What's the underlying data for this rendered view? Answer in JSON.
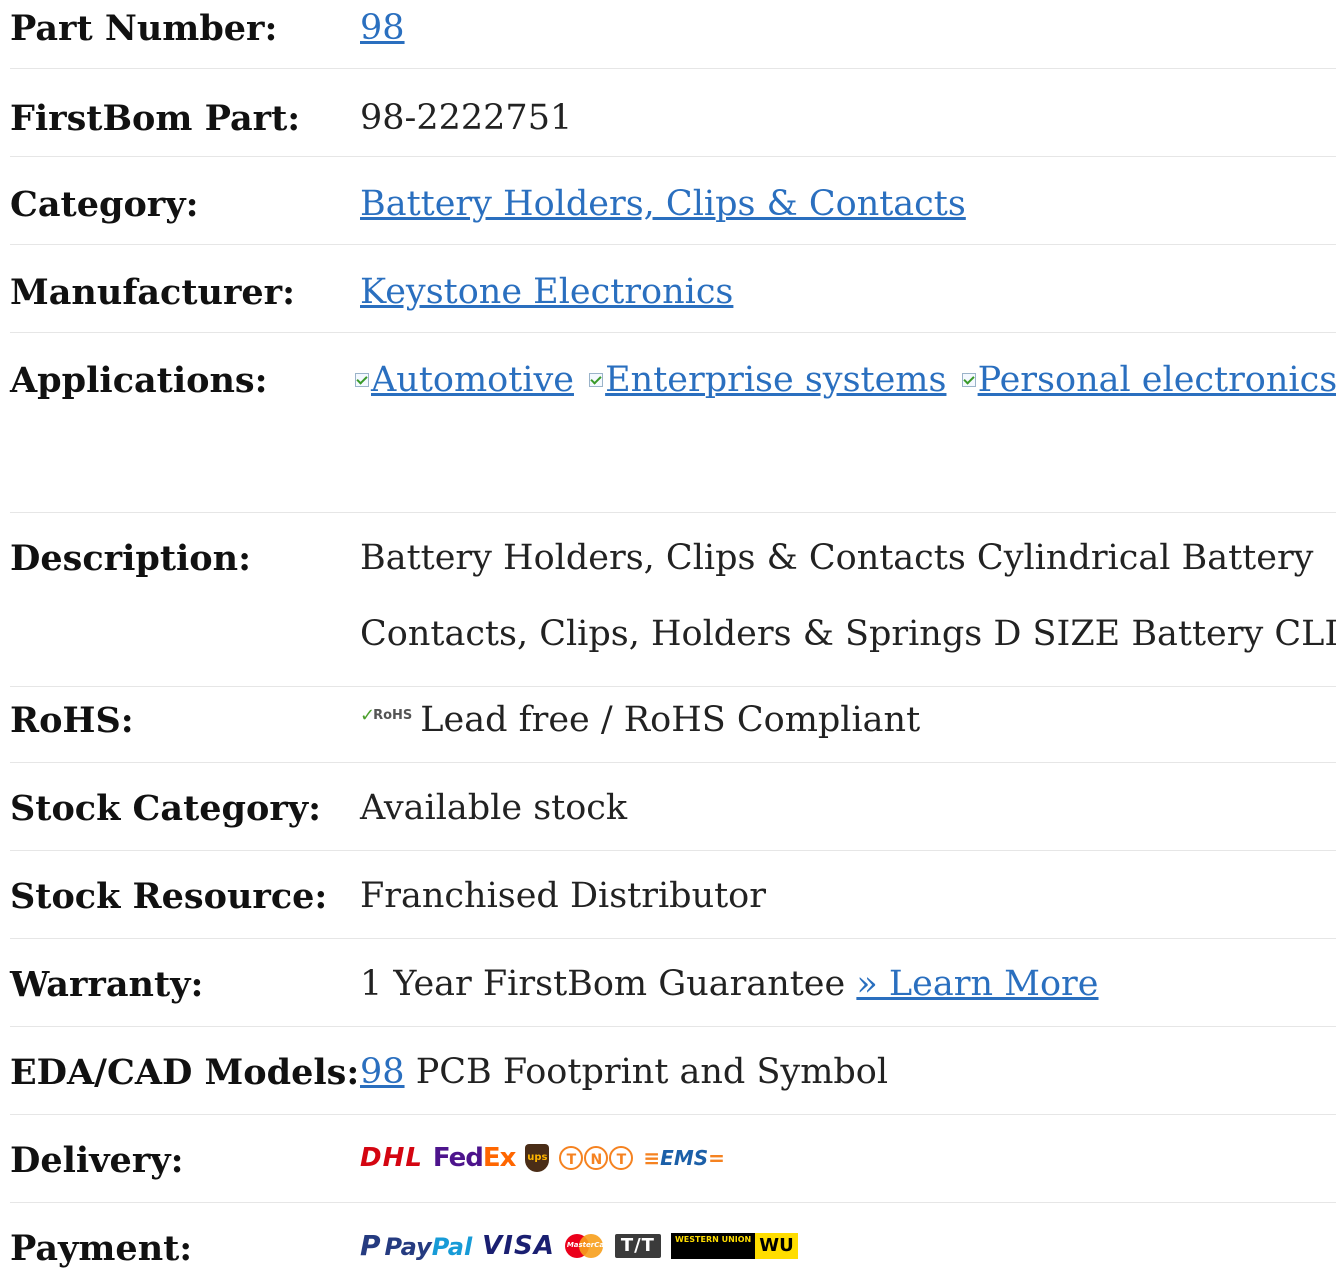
{
  "rows": {
    "part_number": {
      "label": "Part Number:",
      "value": "98"
    },
    "firstbom_part": {
      "label": "FirstBom Part:",
      "value": "98-2222751"
    },
    "category": {
      "label": "Category:",
      "value": "Battery Holders, Clips & Contacts"
    },
    "manufacturer": {
      "label": "Manufacturer:",
      "value": "Keystone Electronics"
    },
    "applications": {
      "label": "Applications:",
      "items": [
        "Automotive",
        "Enterprise systems",
        "Personal electronics"
      ]
    },
    "description": {
      "label": "Description:",
      "line1": "Battery Holders, Clips & Contacts Cylindrical Battery",
      "line2": "Contacts, Clips, Holders & Springs D SIZE Battery CLIP"
    },
    "rohs": {
      "label": "RoHS:",
      "logo_text": "RoHS",
      "value": "Lead free / RoHS Compliant"
    },
    "stock_category": {
      "label": "Stock Category:",
      "value": "Available stock"
    },
    "stock_resource": {
      "label": "Stock Resource:",
      "value": "Franchised Distributor"
    },
    "warranty": {
      "label": "Warranty:",
      "value": "1 Year FirstBom Guarantee",
      "link": "» Learn More"
    },
    "eda_cad": {
      "label": "EDA/CAD Models:",
      "link": "98",
      "value": "PCB Footprint and Symbol"
    },
    "delivery": {
      "label": "Delivery:",
      "logos": {
        "dhl": "DHL",
        "fedex_fe": "Fed",
        "fedex_ex": "Ex",
        "ups": "ups",
        "tnt": [
          "T",
          "N",
          "T"
        ],
        "ems": "EMS"
      }
    },
    "payment": {
      "label": "Payment:",
      "logos": {
        "paypal_p": "P",
        "paypal_pay": "Pay",
        "paypal_pal": "Pal",
        "visa": "VISA",
        "mastercard": "MasterCard",
        "tt": "T/T",
        "wu_top": "WESTERN UNION",
        "wu": "WU"
      }
    }
  },
  "colors": {
    "link": "#2a6fbf",
    "divider": "#e6e6e6",
    "label": "#111111",
    "text": "#222222"
  }
}
